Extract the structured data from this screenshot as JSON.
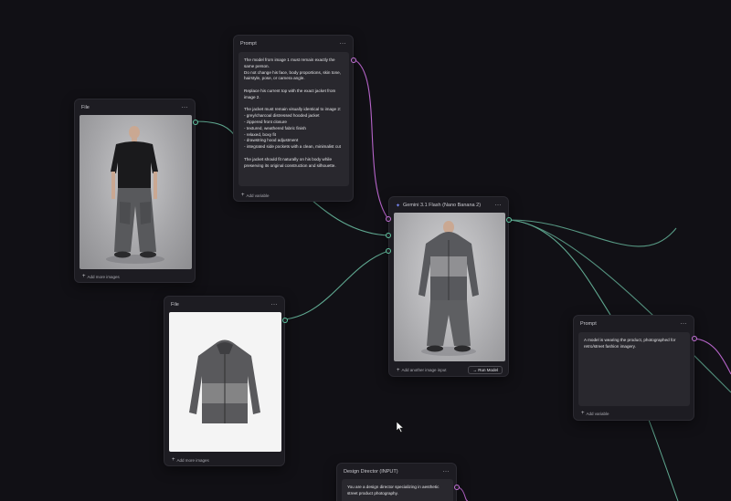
{
  "colors": {
    "canvas_bg": "#111015",
    "node_bg": "#1d1c22",
    "panel_bg": "#29282e",
    "port_green": "#5fc6a0",
    "port_pink": "#c570d8",
    "gemini_accent": "#7b8cff"
  },
  "nodes": {
    "file1": {
      "title": "File",
      "menu": "⋯",
      "footer_link": "Add more images",
      "image_desc": "model-photo-black-tee-grey-cargo"
    },
    "prompt1": {
      "title": "Prompt",
      "menu": "⋯",
      "text": "The model from image 1 must remain exactly the same person.\nDo not change his face, body proportions, skin tone, hairstyle, pose, or camera angle.\n\nReplace his current top with the exact jacket from image 2.\n\nThe jacket must remain visually identical to image 2:\n- grey/charcoal distressed hooded jacket\n- zippered front closure\n- textured, weathered fabric finish\n- relaxed, boxy fit\n- drawstring hood adjustment\n- integrated side pockets with a clean, minimalist cut\n\nThe jacket should fit naturally on his body while preserving its original construction and silhouette.",
      "footer_link": "Add variable"
    },
    "file2": {
      "title": "File",
      "menu": "⋯",
      "footer_link": "Add more images",
      "image_desc": "grey-distressed-hooded-jacket"
    },
    "gemini": {
      "title": "Gemini 3.1 Flash (Nano Banana 2)",
      "menu": "⋯",
      "footer_link": "Add another image input",
      "run_label": "Run Model",
      "image_desc": "model-wearing-grey-jacket"
    },
    "prompt2": {
      "title": "Prompt",
      "menu": "⋯",
      "text": "A model is wearing the product, photographed for retro/street fashion imagery.",
      "footer_link": "Add variable"
    },
    "director": {
      "title": "Design Director (INPUT)",
      "menu": "⋯",
      "text": "You are a design director specializing in aesthetic street product photography."
    }
  }
}
